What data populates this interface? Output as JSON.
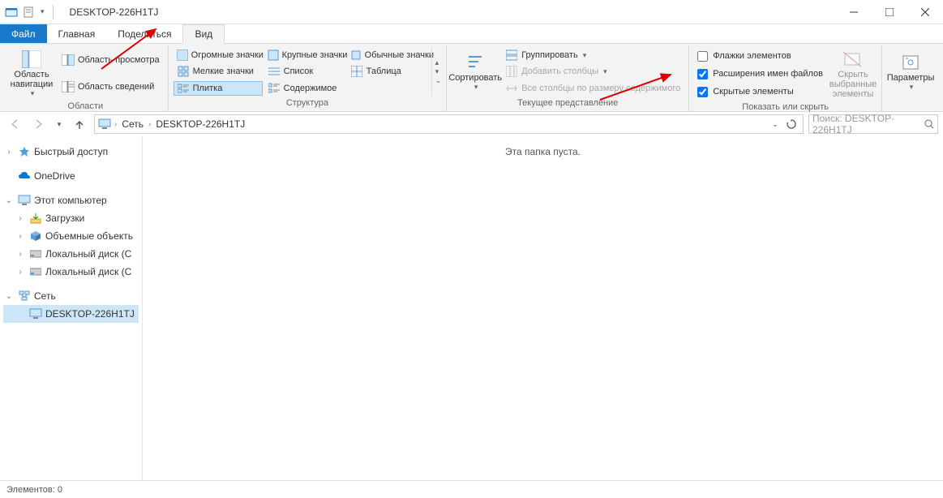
{
  "window": {
    "title": "DESKTOP-226H1TJ"
  },
  "tabs": {
    "file": "Файл",
    "home": "Главная",
    "share": "Поделиться",
    "view": "Вид"
  },
  "ribbon": {
    "panes": {
      "nav_pane": "Область навигации",
      "preview": "Область просмотра",
      "details": "Область сведений",
      "group": "Области"
    },
    "layout": {
      "huge": "Огромные значки",
      "large": "Крупные значки",
      "medium": "Обычные значки",
      "small": "Мелкие значки",
      "list": "Список",
      "table": "Таблица",
      "tiles": "Плитка",
      "content": "Содержимое",
      "group": "Структура"
    },
    "current": {
      "sort": "Сортировать",
      "group_by": "Группировать",
      "add_cols": "Добавить столбцы",
      "size_cols": "Все столбцы по размеру содержимого",
      "group": "Текущее представление"
    },
    "show": {
      "checkboxes": "Флажки элементов",
      "extensions": "Расширения имен файлов",
      "hidden": "Скрытые элементы",
      "hide_selected": "Скрыть выбранные элементы",
      "group": "Показать или скрыть"
    },
    "options": "Параметры"
  },
  "address": {
    "network": "Сеть",
    "host": "DESKTOP-226H1TJ",
    "search_placeholder": "Поиск: DESKTOP-226H1TJ"
  },
  "sidebar": {
    "quick": "Быстрый доступ",
    "onedrive": "OneDrive",
    "thispc": "Этот компьютер",
    "downloads": "Загрузки",
    "volumes": "Объемные объекть",
    "localc": "Локальный диск (С",
    "locald": "Локальный диск (С",
    "network": "Сеть",
    "host": "DESKTOP-226H1TJ"
  },
  "content": {
    "empty": "Эта папка пуста."
  },
  "status": {
    "items": "Элементов: 0"
  }
}
